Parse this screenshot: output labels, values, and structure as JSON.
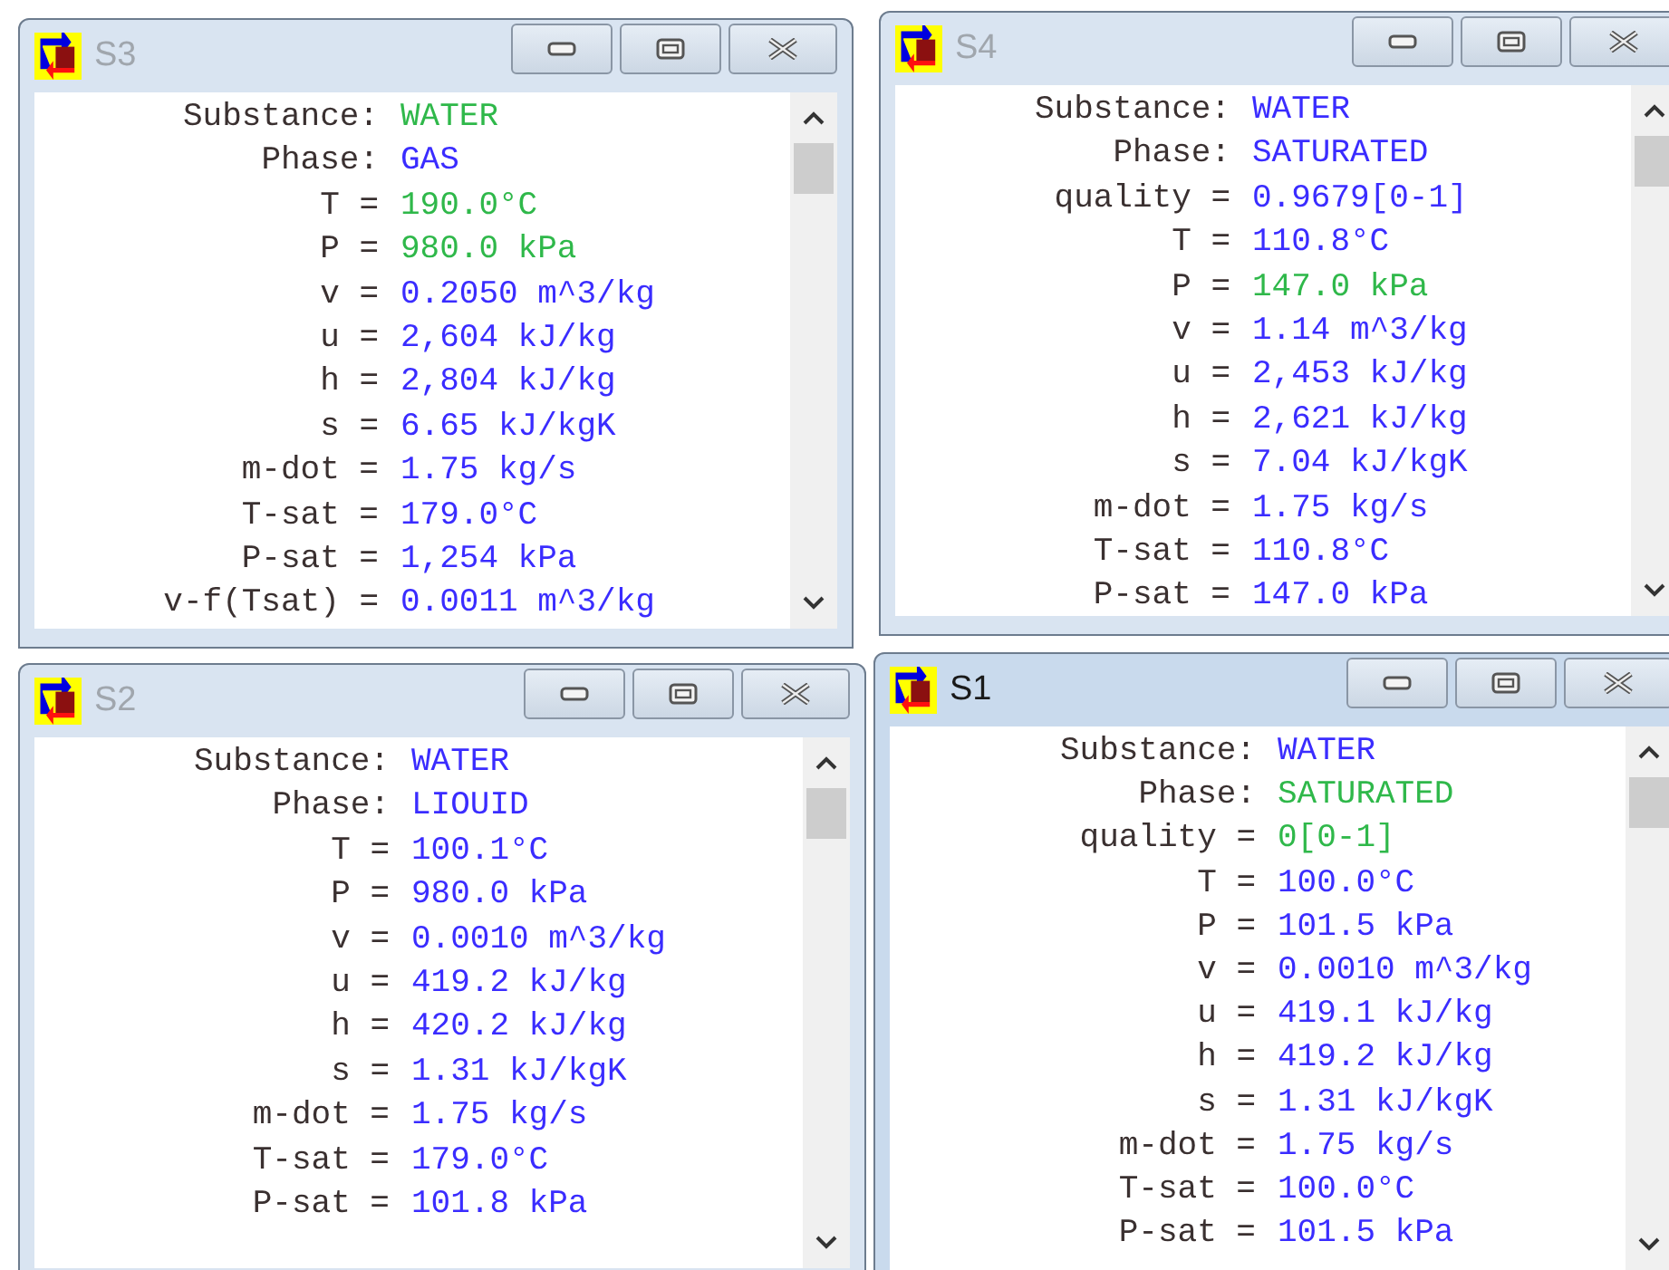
{
  "windows": [
    {
      "title": "S3",
      "active": false,
      "rows": [
        {
          "label": "Substance:",
          "value": "WATER",
          "given": true
        },
        {
          "label": "Phase:",
          "value": "GAS",
          "given": false
        },
        {
          "label": "T =",
          "value": "190.0°C",
          "given": true
        },
        {
          "label": "P =",
          "value": "980.0 kPa",
          "given": true
        },
        {
          "label": "v =",
          "value": "0.2050 m^3/kg",
          "given": false
        },
        {
          "label": "u =",
          "value": "2,604 kJ/kg",
          "given": false
        },
        {
          "label": "h =",
          "value": "2,804 kJ/kg",
          "given": false
        },
        {
          "label": "s =",
          "value": "6.65 kJ/kgK",
          "given": false
        },
        {
          "label": "m-dot =",
          "value": "1.75 kg/s",
          "given": false
        },
        {
          "label": "T-sat =",
          "value": "179.0°C",
          "given": false
        },
        {
          "label": "P-sat =",
          "value": "1,254 kPa",
          "given": false
        },
        {
          "label": "v-f(Tsat) =",
          "value": "0.0011 m^3/kg",
          "given": false
        }
      ]
    },
    {
      "title": "S4",
      "active": false,
      "rows": [
        {
          "label": "Substance:",
          "value": "WATER",
          "given": false
        },
        {
          "label": "Phase:",
          "value": "SATURATED",
          "given": false
        },
        {
          "label": "quality =",
          "value": "0.9679[0-1]",
          "given": false
        },
        {
          "label": "T =",
          "value": "110.8°C",
          "given": false
        },
        {
          "label": "P =",
          "value": "147.0 kPa",
          "given": true
        },
        {
          "label": "v =",
          "value": "1.14 m^3/kg",
          "given": false
        },
        {
          "label": "u =",
          "value": "2,453 kJ/kg",
          "given": false
        },
        {
          "label": "h =",
          "value": "2,621 kJ/kg",
          "given": false
        },
        {
          "label": "s =",
          "value": "7.04 kJ/kgK",
          "given": false
        },
        {
          "label": "m-dot =",
          "value": "1.75 kg/s",
          "given": false
        },
        {
          "label": "T-sat =",
          "value": "110.8°C",
          "given": false
        },
        {
          "label": "P-sat =",
          "value": "147.0 kPa",
          "given": false
        }
      ]
    },
    {
      "title": "S2",
      "active": false,
      "rows": [
        {
          "label": "Substance:",
          "value": "WATER",
          "given": false
        },
        {
          "label": "Phase:",
          "value": "LIOUID",
          "given": false
        },
        {
          "label": "T =",
          "value": "100.1°C",
          "given": false
        },
        {
          "label": "P =",
          "value": "980.0 kPa",
          "given": false
        },
        {
          "label": "v =",
          "value": "0.0010 m^3/kg",
          "given": false
        },
        {
          "label": "u =",
          "value": "419.2 kJ/kg",
          "given": false
        },
        {
          "label": "h =",
          "value": "420.2 kJ/kg",
          "given": false
        },
        {
          "label": "s =",
          "value": "1.31 kJ/kgK",
          "given": false
        },
        {
          "label": "m-dot =",
          "value": "1.75 kg/s",
          "given": false
        },
        {
          "label": "T-sat =",
          "value": "179.0°C",
          "given": false
        },
        {
          "label": "P-sat =",
          "value": "101.8 kPa",
          "given": false
        }
      ]
    },
    {
      "title": "S1",
      "active": true,
      "rows": [
        {
          "label": "Substance:",
          "value": "WATER",
          "given": false
        },
        {
          "label": "Phase:",
          "value": "SATURATED",
          "given": true
        },
        {
          "label": "quality =",
          "value": "0[0-1]",
          "given": true
        },
        {
          "label": "T =",
          "value": "100.0°C",
          "given": false
        },
        {
          "label": "P =",
          "value": "101.5 kPa",
          "given": false
        },
        {
          "label": "v =",
          "value": "0.0010 m^3/kg",
          "given": false
        },
        {
          "label": "u =",
          "value": "419.1 kJ/kg",
          "given": false
        },
        {
          "label": "h =",
          "value": "419.2 kJ/kg",
          "given": false
        },
        {
          "label": "s =",
          "value": "1.31 kJ/kgK",
          "given": false
        },
        {
          "label": "m-dot =",
          "value": "1.75 kg/s",
          "given": false
        },
        {
          "label": "T-sat =",
          "value": "100.0°C",
          "given": false
        },
        {
          "label": "P-sat =",
          "value": "101.5 kPa",
          "given": false
        }
      ]
    }
  ]
}
